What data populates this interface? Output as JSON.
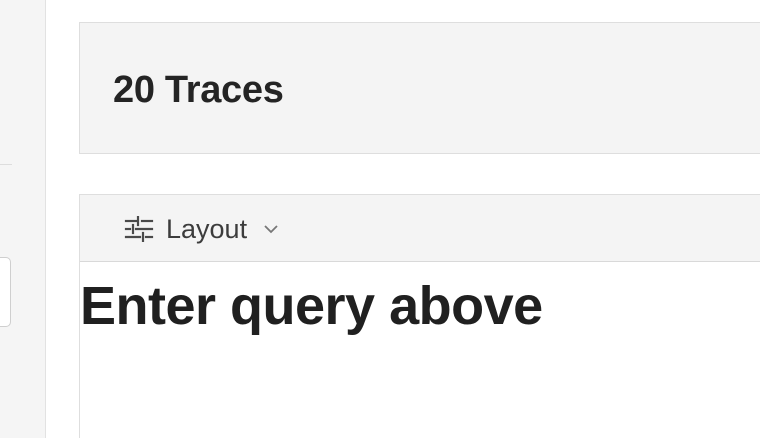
{
  "header": {
    "trace_count_label": "20 Traces"
  },
  "results": {
    "toolbar": {
      "layout_label": "Layout"
    },
    "empty_message": "Enter query above"
  },
  "icons": {
    "layout": "sliders-icon",
    "layout_dropdown": "chevron-down-icon"
  }
}
